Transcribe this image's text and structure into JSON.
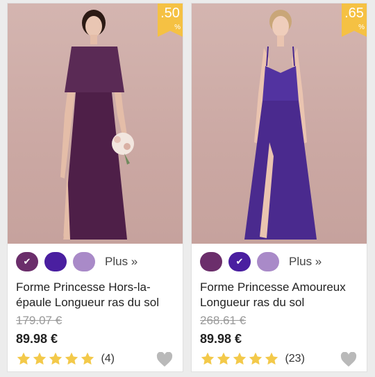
{
  "products": [
    {
      "discount": ".50",
      "discount_symbol": "%",
      "colors": [
        {
          "name": "grape",
          "hex": "#6b2e6b",
          "selected": true
        },
        {
          "name": "regency",
          "hex": "#4a1fa0",
          "selected": false
        },
        {
          "name": "lilac",
          "hex": "#a98ac8",
          "selected": false
        }
      ],
      "more_label": "Plus »",
      "title": "Forme Princesse Hors-la-épaule Longueur ras du sol",
      "old_price": "179.07 €",
      "price": "89.98 €",
      "rating": 5,
      "review_count": "(4)",
      "image_icon": "off-shoulder-dress-photo",
      "dress_color": "#4e1f48"
    },
    {
      "discount": ".65",
      "discount_symbol": "%",
      "colors": [
        {
          "name": "grape",
          "hex": "#6b2e6b",
          "selected": false
        },
        {
          "name": "regency",
          "hex": "#4a1fa0",
          "selected": true
        },
        {
          "name": "lilac",
          "hex": "#a98ac8",
          "selected": false
        }
      ],
      "more_label": "Plus »",
      "title": "Forme Princesse Amoureux Longueur ras du sol",
      "old_price": "268.61 €",
      "price": "89.98 €",
      "rating": 5,
      "review_count": "(23)",
      "image_icon": "spaghetti-strap-dress-photo",
      "dress_color": "#4a2a8e"
    }
  ],
  "icons": {
    "check": "✔",
    "star_color": "#f3c94a",
    "heart_color": "#b9b9b9"
  }
}
